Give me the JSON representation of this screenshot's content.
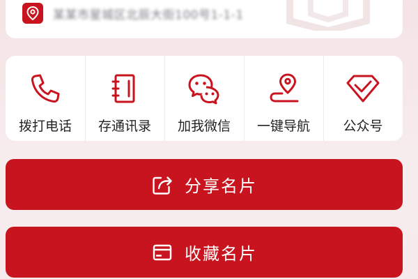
{
  "address": {
    "text": "某某市星城区北辰大街100号1-1-1",
    "icon": "location-pin-icon"
  },
  "actions": [
    {
      "label": "拨打电话",
      "icon": "phone-icon"
    },
    {
      "label": "存通讯录",
      "icon": "address-book-icon"
    },
    {
      "label": "加我微信",
      "icon": "wechat-icon"
    },
    {
      "label": "一键导航",
      "icon": "navigation-icon"
    },
    {
      "label": "公众号",
      "icon": "official-account-icon"
    }
  ],
  "buttons": {
    "share_label": "分享名片",
    "share_icon": "share-icon",
    "collect_label": "收藏名片",
    "collect_icon": "card-icon"
  },
  "colors": {
    "accent": "#c8141e",
    "background": "#f4e3e4",
    "card": "#ffffff"
  }
}
